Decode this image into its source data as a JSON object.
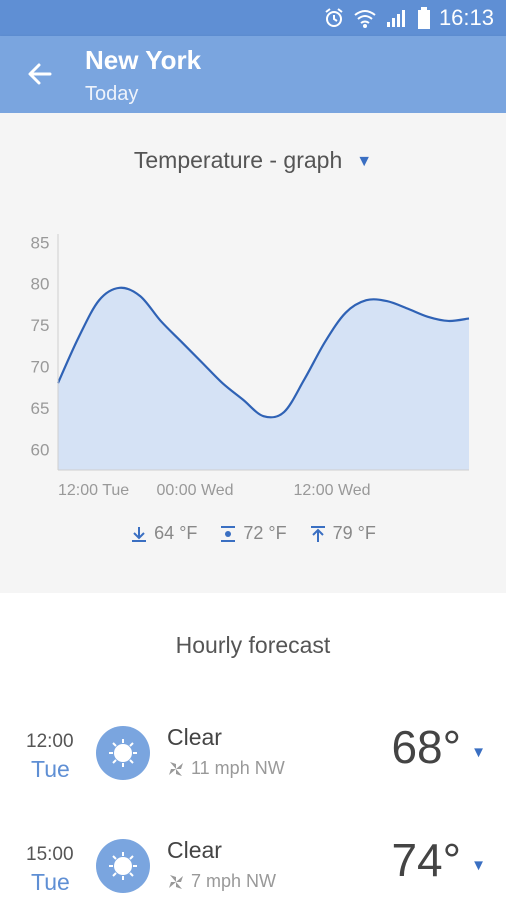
{
  "status_bar": {
    "time": "16:13"
  },
  "header": {
    "title": "New York",
    "subtitle": "Today"
  },
  "graph": {
    "selector_label": "Temperature - graph",
    "stats": {
      "min": "64 °F",
      "avg": "72 °F",
      "max": "79 °F"
    }
  },
  "chart_data": {
    "type": "area",
    "x_tick_labels": [
      "12:00 Tue",
      "00:00 Wed",
      "12:00 Wed"
    ],
    "y_ticks": [
      85,
      80,
      75,
      70,
      65,
      60
    ],
    "ylim": [
      57.5,
      86
    ],
    "x": [
      0,
      2,
      4,
      6,
      8,
      10,
      12,
      14,
      16,
      18,
      20,
      22,
      24,
      26,
      28,
      30,
      32,
      34,
      36,
      38,
      40
    ],
    "series": [
      {
        "values": [
          68,
          73.5,
          78,
          79.5,
          78.5,
          75.5,
          73,
          70.5,
          68,
          66,
          64,
          64.5,
          68.5,
          73,
          76.5,
          78,
          77.9,
          77,
          76,
          75.5,
          75.8
        ]
      }
    ],
    "fill_color": "#d5e2f5",
    "line_color": "#2f62b5",
    "grid": false
  },
  "hourly": {
    "title": "Hourly forecast",
    "rows": [
      {
        "time": "12:00",
        "day": "Tue",
        "condition": "Clear",
        "wind": "11 mph NW",
        "temp": "68°"
      },
      {
        "time": "15:00",
        "day": "Tue",
        "condition": "Clear",
        "wind": "7 mph NW",
        "temp": "74°"
      }
    ]
  }
}
